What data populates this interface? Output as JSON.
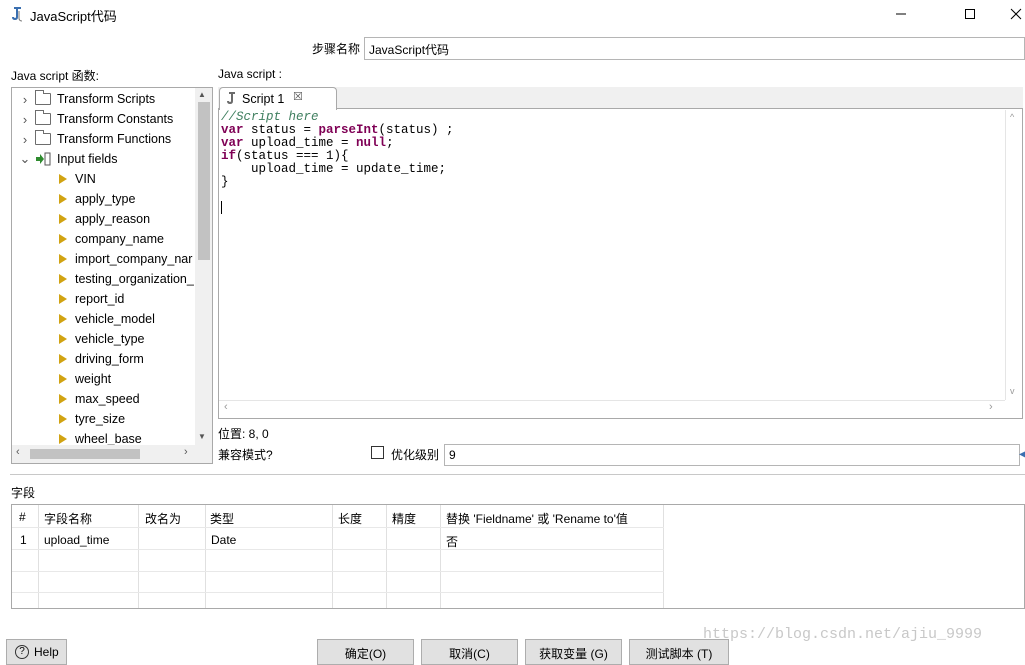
{
  "window": {
    "title": "JavaScript代码",
    "icon": "javascript-step-icon",
    "minimize_glyph": "—",
    "maximize_glyph": "☐",
    "close_glyph": "✕"
  },
  "step_name": {
    "label": "步骤名称",
    "value": "JavaScript代码"
  },
  "functions_panel": {
    "label": "Java script 函数:",
    "tree": [
      {
        "label": "Transform Scripts",
        "icon": "folder-icon",
        "expanded": false
      },
      {
        "label": "Transform Constants",
        "icon": "folder-icon",
        "expanded": false
      },
      {
        "label": "Transform Functions",
        "icon": "folder-icon",
        "expanded": false
      },
      {
        "label": "Input fields",
        "icon": "input-fields-icon",
        "expanded": true
      },
      {
        "label": "VIN",
        "icon": "field-icon"
      },
      {
        "label": "apply_type",
        "icon": "field-icon"
      },
      {
        "label": "apply_reason",
        "icon": "field-icon"
      },
      {
        "label": "company_name",
        "icon": "field-icon"
      },
      {
        "label": "import_company_nar",
        "icon": "field-icon"
      },
      {
        "label": "testing_organization_",
        "icon": "field-icon"
      },
      {
        "label": "report_id",
        "icon": "field-icon"
      },
      {
        "label": "vehicle_model",
        "icon": "field-icon"
      },
      {
        "label": "vehicle_type",
        "icon": "field-icon"
      },
      {
        "label": "driving_form",
        "icon": "field-icon"
      },
      {
        "label": "weight",
        "icon": "field-icon"
      },
      {
        "label": "max_speed",
        "icon": "field-icon"
      },
      {
        "label": "tyre_size",
        "icon": "field-icon"
      },
      {
        "label": "wheel_base",
        "icon": "field-icon"
      }
    ]
  },
  "script_panel": {
    "label": "Java script :",
    "tab_label": "Script 1",
    "code_lines": [
      [
        {
          "t": "//Script here",
          "c": "cm"
        }
      ],
      [
        {
          "t": "var",
          "c": "kw"
        },
        {
          "t": " status = "
        },
        {
          "t": "parseInt",
          "c": "fn"
        },
        {
          "t": "(status) ;"
        }
      ],
      [
        {
          "t": "var",
          "c": "kw"
        },
        {
          "t": " upload_time = "
        },
        {
          "t": "null",
          "c": "kw"
        },
        {
          "t": ";"
        }
      ],
      [
        {
          "t": "if",
          "c": "kw"
        },
        {
          "t": "(status === 1){"
        }
      ],
      [
        {
          "t": "    upload_time = update_time;"
        }
      ],
      [
        {
          "t": "}"
        }
      ],
      [
        {
          "t": ""
        }
      ],
      [
        {
          "t": ""
        }
      ]
    ]
  },
  "position": {
    "text": "位置: 8, 0"
  },
  "compat_mode": {
    "label": "兼容模式?",
    "checked": false
  },
  "optimization": {
    "label": "优化级别",
    "value": "9"
  },
  "fields": {
    "label": "字段",
    "headers": [
      "#",
      "字段名称",
      "改名为",
      "类型",
      "长度",
      "精度",
      "替换 'Fieldname' 或 'Rename to'值"
    ],
    "rows": [
      [
        "1",
        "upload_time",
        "",
        "Date",
        "",
        "",
        "否"
      ]
    ]
  },
  "buttons": {
    "help": "Help",
    "ok": "确定(O)",
    "cancel": "取消(C)",
    "get_variables": "获取变量 (G)",
    "test_script": "测试脚本 (T)"
  },
  "watermark": "https://blog.csdn.net/ajiu_9999",
  "colors": {
    "keyword": "#7f0055",
    "comment": "#3f7f5f",
    "field_icon": "#d1a312",
    "input_icon": "#2e8b2e"
  }
}
